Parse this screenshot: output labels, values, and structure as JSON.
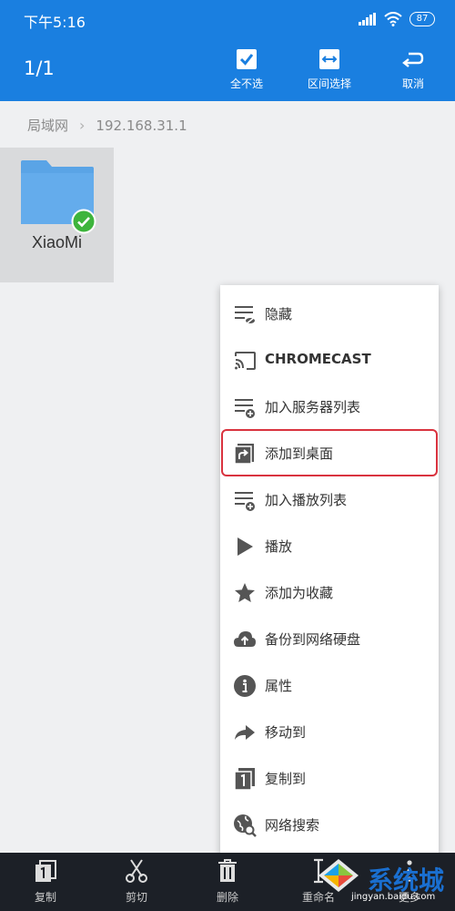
{
  "status_bar": {
    "time": "下午5:16",
    "battery": "87"
  },
  "action_bar": {
    "count": "1/1",
    "actions": [
      {
        "label": "全不选",
        "icon": "checkbox-icon"
      },
      {
        "label": "区间选择",
        "icon": "range-select-icon"
      },
      {
        "label": "取消",
        "icon": "undo-icon"
      }
    ]
  },
  "breadcrumb": {
    "root": "局域网",
    "current": "192.168.31.1"
  },
  "folder": {
    "name": "XiaoMi",
    "selected": true
  },
  "context_menu": {
    "items": [
      {
        "label": "隐藏",
        "icon": "hide-list-icon"
      },
      {
        "label": "CHROMECAST",
        "icon": "cast-icon"
      },
      {
        "label": "加入服务器列表",
        "icon": "add-to-list-icon"
      },
      {
        "label": "添加到桌面",
        "icon": "add-shortcut-icon"
      },
      {
        "label": "加入播放列表",
        "icon": "add-to-playlist-icon"
      },
      {
        "label": "播放",
        "icon": "play-icon"
      },
      {
        "label": "添加为收藏",
        "icon": "star-icon"
      },
      {
        "label": "备份到网络硬盘",
        "icon": "cloud-upload-icon"
      },
      {
        "label": "属性",
        "icon": "info-icon"
      },
      {
        "label": "移动到",
        "icon": "move-arrow-icon"
      },
      {
        "label": "复制到",
        "icon": "copy-to-icon"
      },
      {
        "label": "网络搜索",
        "icon": "web-search-icon"
      }
    ],
    "highlighted_index": 3,
    "highlight_color": "#d9333f"
  },
  "bottom_bar": {
    "items": [
      {
        "label": "复制",
        "icon": "copy-icon"
      },
      {
        "label": "剪切",
        "icon": "scissors-icon"
      },
      {
        "label": "删除",
        "icon": "trash-icon"
      },
      {
        "label": "重命名",
        "icon": "rename-icon"
      },
      {
        "label": "更多",
        "icon": "more-icon"
      }
    ]
  },
  "watermark": {
    "text": "系统城",
    "url": "jingyan.baidu.com"
  },
  "colors": {
    "primary": "#1a7fe0",
    "folder": "#5aa4e6",
    "check": "#3db43c",
    "bottom_bar": "#1c2027"
  }
}
